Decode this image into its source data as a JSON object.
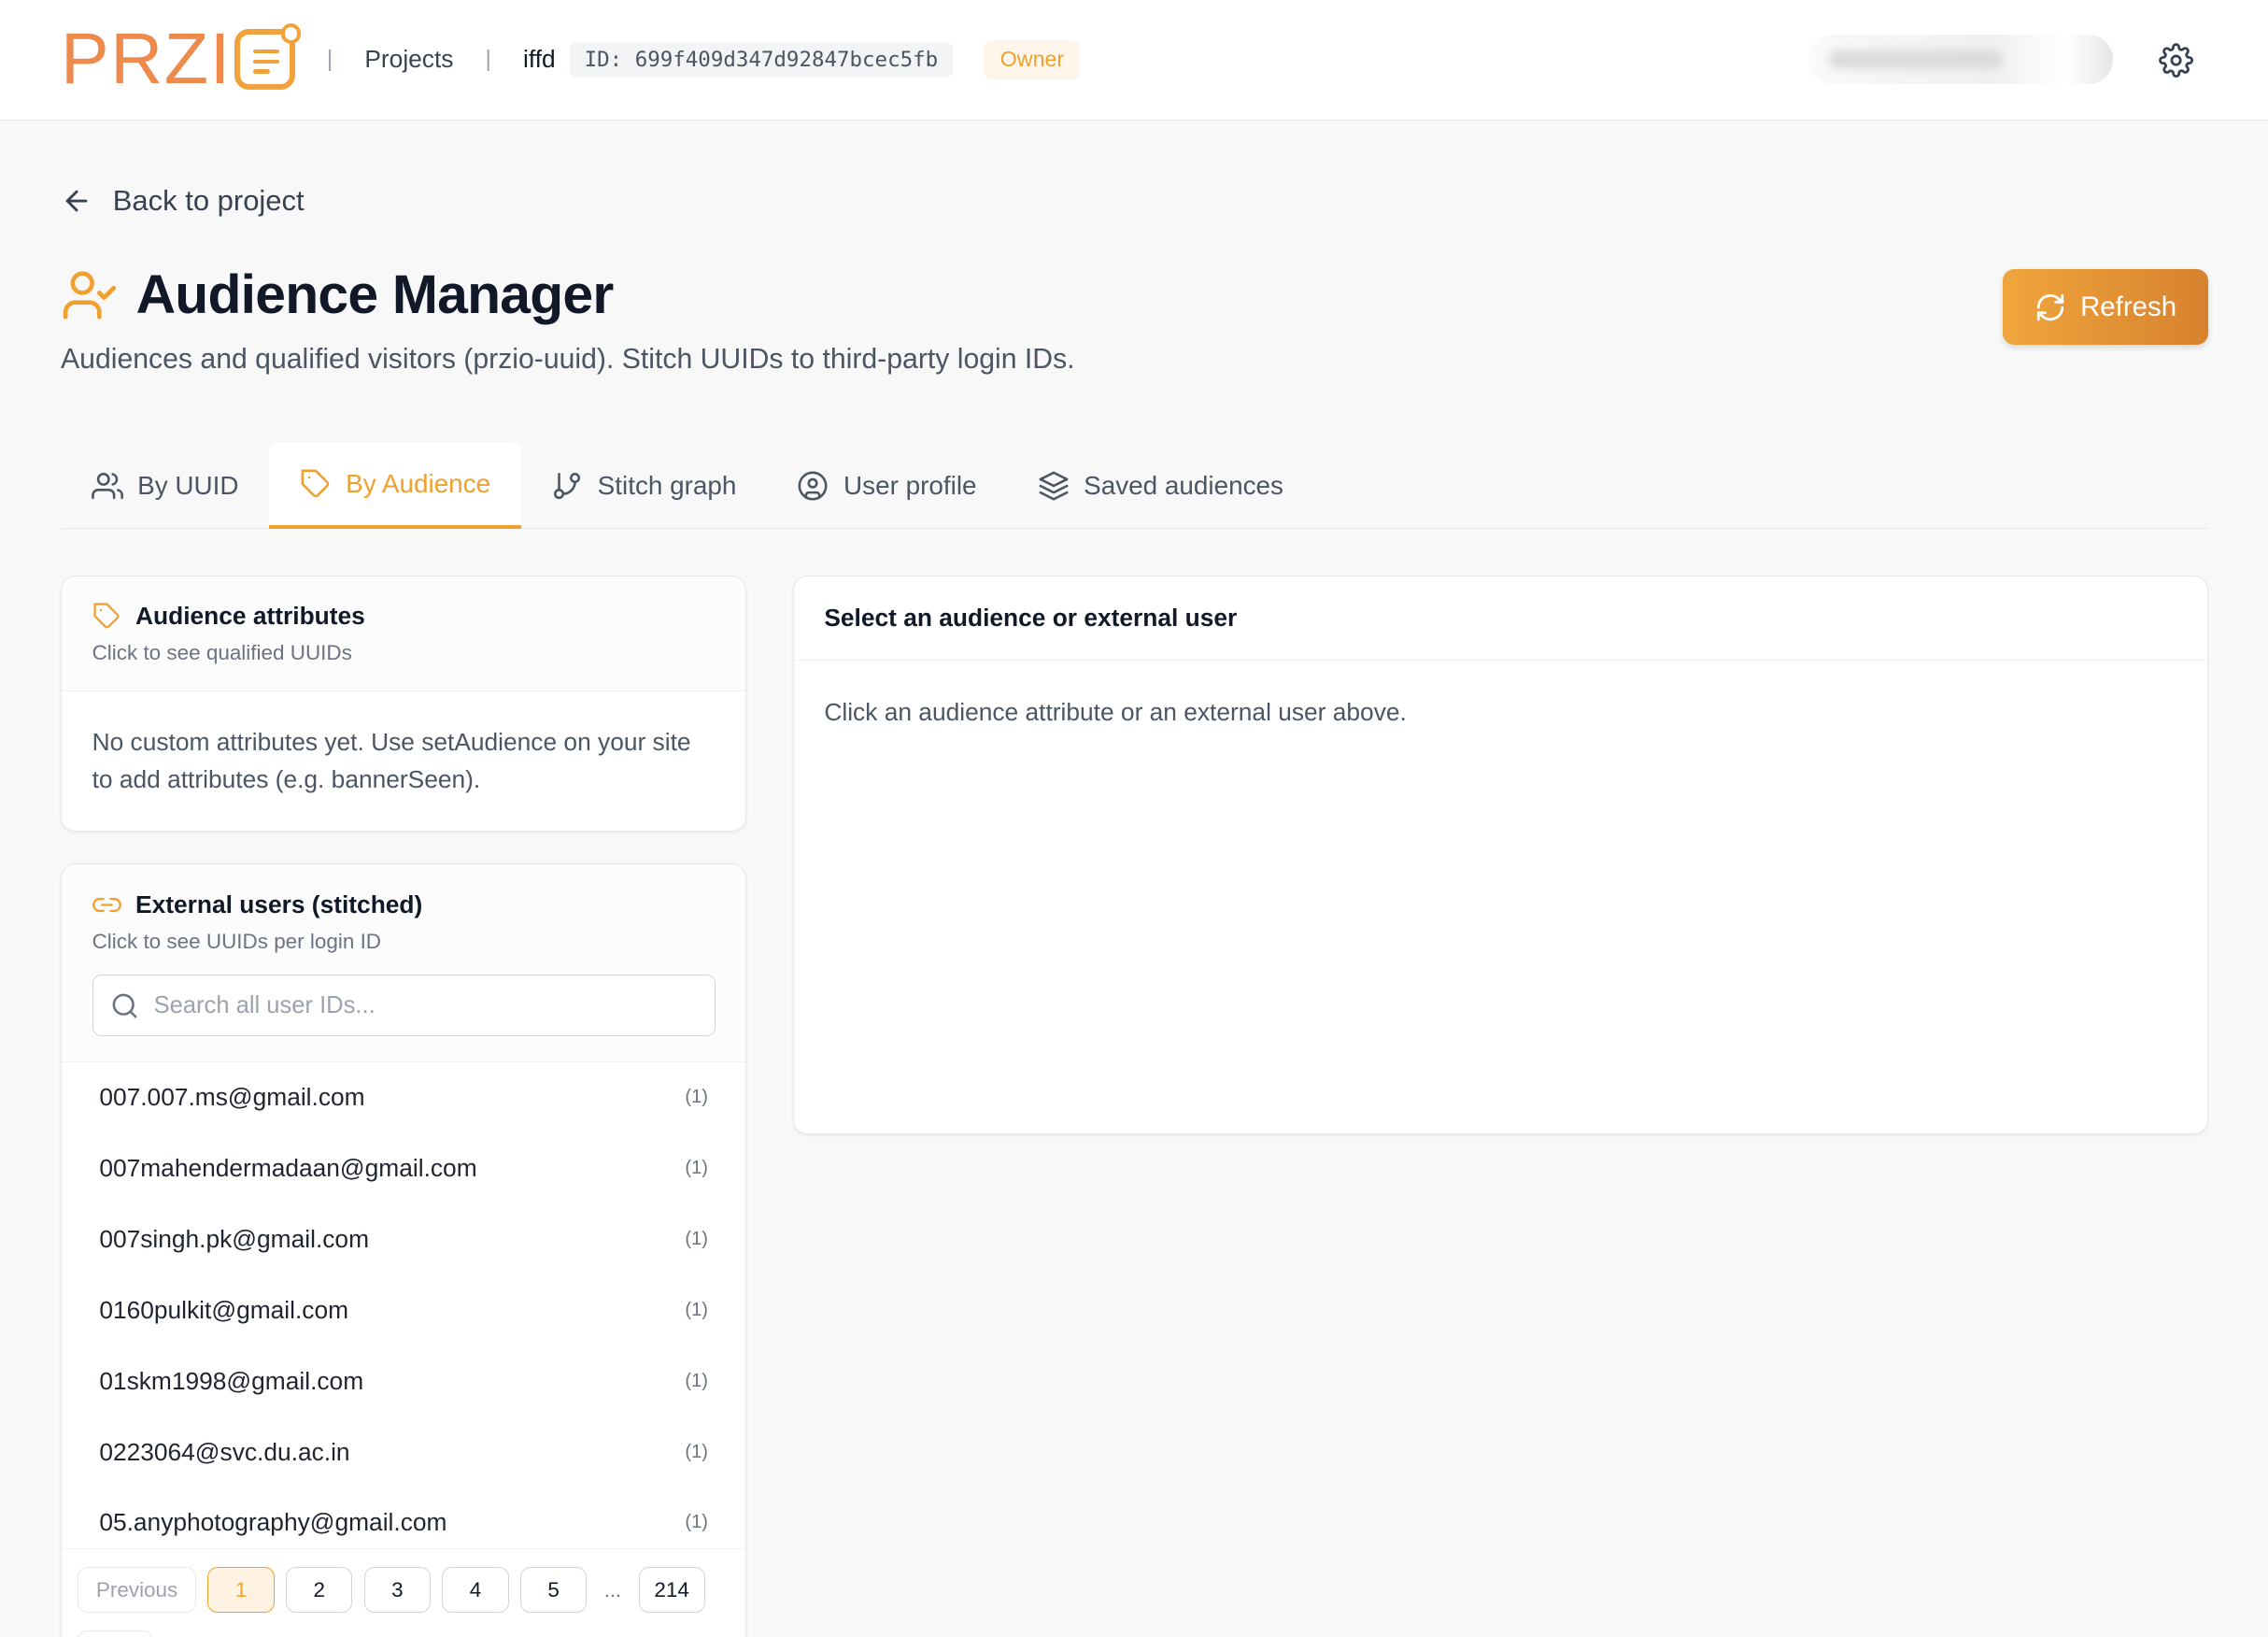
{
  "header": {
    "logo_text": "PRZI",
    "projects_link": "Projects",
    "project_name": "iffd",
    "project_id": "ID: 699f409d347d92847bcec5fb",
    "role_badge": "Owner"
  },
  "back_link": "Back to project",
  "page": {
    "title": "Audience Manager",
    "subtitle": "Audiences and qualified visitors (przio-uuid). Stitch UUIDs to third-party login IDs.",
    "refresh_label": "Refresh"
  },
  "tabs": [
    {
      "label": "By UUID",
      "icon": "users-icon",
      "active": false
    },
    {
      "label": "By Audience",
      "icon": "tag-icon",
      "active": true
    },
    {
      "label": "Stitch graph",
      "icon": "branch-icon",
      "active": false
    },
    {
      "label": "User profile",
      "icon": "user-circle-icon",
      "active": false
    },
    {
      "label": "Saved audiences",
      "icon": "layers-icon",
      "active": false
    }
  ],
  "attributes_card": {
    "title": "Audience attributes",
    "subtitle": "Click to see qualified UUIDs",
    "empty_text": "No custom attributes yet. Use setAudience on your site to add attributes (e.g. bannerSeen)."
  },
  "external_card": {
    "title": "External users (stitched)",
    "subtitle": "Click to see UUIDs per login ID",
    "search_placeholder": "Search all user IDs...",
    "items": [
      {
        "id": "007.007.ms@gmail.com",
        "count": "(1)"
      },
      {
        "id": "007mahendermadaan@gmail.com",
        "count": "(1)"
      },
      {
        "id": "007singh.pk@gmail.com",
        "count": "(1)"
      },
      {
        "id": "0160pulkit@gmail.com",
        "count": "(1)"
      },
      {
        "id": "01skm1998@gmail.com",
        "count": "(1)"
      },
      {
        "id": "0223064@svc.du.ac.in",
        "count": "(1)"
      },
      {
        "id": "05.anyphotography@gmail.com",
        "count": "(1)"
      }
    ],
    "pagination": {
      "previous": "Previous",
      "pages": [
        "1",
        "2",
        "3",
        "4",
        "5"
      ],
      "ellipsis": "...",
      "last": "214",
      "current": "1"
    }
  },
  "detail_card": {
    "title": "Select an audience or external user",
    "empty_text": "Click an audience attribute or an external user above."
  },
  "colors": {
    "accent": "#f0a02e",
    "accent_dark": "#d7822f",
    "logo": "#ee8a4c"
  }
}
